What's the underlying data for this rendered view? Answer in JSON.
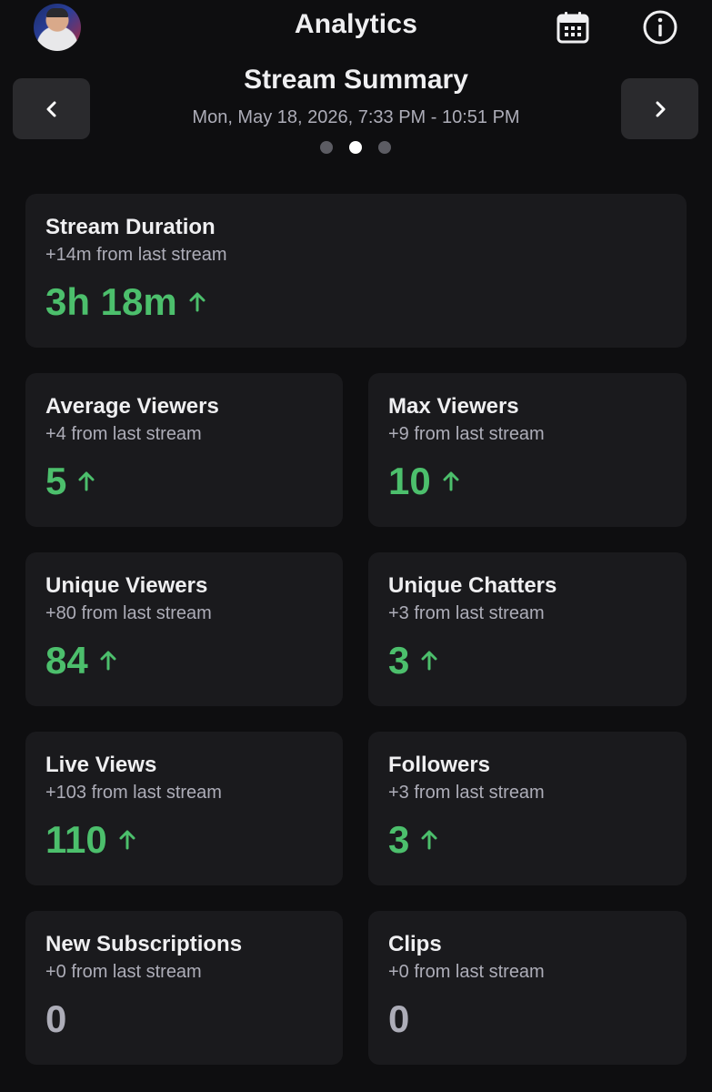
{
  "header": {
    "title": "Analytics",
    "icons": [
      "avatar",
      "calendar-icon",
      "info-icon"
    ]
  },
  "summary": {
    "title": "Stream Summary",
    "date_range": "Mon, May 18, 2026, 7:33 PM - 10:51 PM",
    "page_count": 3,
    "active_page": 2
  },
  "colors": {
    "background": "#0e0e10",
    "card": "#1a1a1d",
    "positive": "#4cbf6c",
    "muted": "#adadb8"
  },
  "stats": {
    "duration": {
      "label": "Stream Duration",
      "delta": "+14m from last stream",
      "value": "3h 18m",
      "trend": "up"
    },
    "avg_viewers": {
      "label": "Average Viewers",
      "delta": "+4 from last stream",
      "value": "5",
      "trend": "up"
    },
    "max_viewers": {
      "label": "Max Viewers",
      "delta": "+9 from last stream",
      "value": "10",
      "trend": "up"
    },
    "unique_viewers": {
      "label": "Unique Viewers",
      "delta": "+80 from last stream",
      "value": "84",
      "trend": "up"
    },
    "unique_chatters": {
      "label": "Unique Chatters",
      "delta": "+3 from last stream",
      "value": "3",
      "trend": "up"
    },
    "live_views": {
      "label": "Live Views",
      "delta": "+103 from last stream",
      "value": "110",
      "trend": "up"
    },
    "followers": {
      "label": "Followers",
      "delta": "+3 from last stream",
      "value": "3",
      "trend": "up"
    },
    "new_subs": {
      "label": "New Subscriptions",
      "delta": "+0 from last stream",
      "value": "0",
      "trend": "none"
    },
    "clips": {
      "label": "Clips",
      "delta": "+0 from last stream",
      "value": "0",
      "trend": "none"
    }
  }
}
